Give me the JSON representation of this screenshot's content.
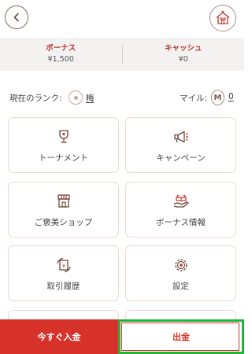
{
  "header": {
    "back_icon": "chevron-left-icon",
    "home_icon": "house-icon"
  },
  "balances": {
    "bonus_label": "ボーナス",
    "bonus_value": "¥1,500",
    "cash_label": "キャッシュ",
    "cash_value": "¥0"
  },
  "rank": {
    "label": "現在のランク:",
    "value": "梅",
    "mile_label": "マイル:",
    "mile_icon_letter": "M",
    "mile_value": "0"
  },
  "menu": [
    {
      "label": "トーナメント",
      "icon": "trophy-icon"
    },
    {
      "label": "キャンペーン",
      "icon": "megaphone-icon"
    },
    {
      "label": "ご褒美ショップ",
      "icon": "shop-icon"
    },
    {
      "label": "ボーナス情報",
      "icon": "gift-icon"
    },
    {
      "label": "取引履歴",
      "icon": "history-icon"
    },
    {
      "label": "設定",
      "icon": "gear-icon"
    }
  ],
  "bottom": {
    "deposit_label": "今すぐ入金",
    "withdraw_label": "出金"
  },
  "colors": {
    "accent": "#d7322a",
    "highlight": "#1fb53a"
  }
}
